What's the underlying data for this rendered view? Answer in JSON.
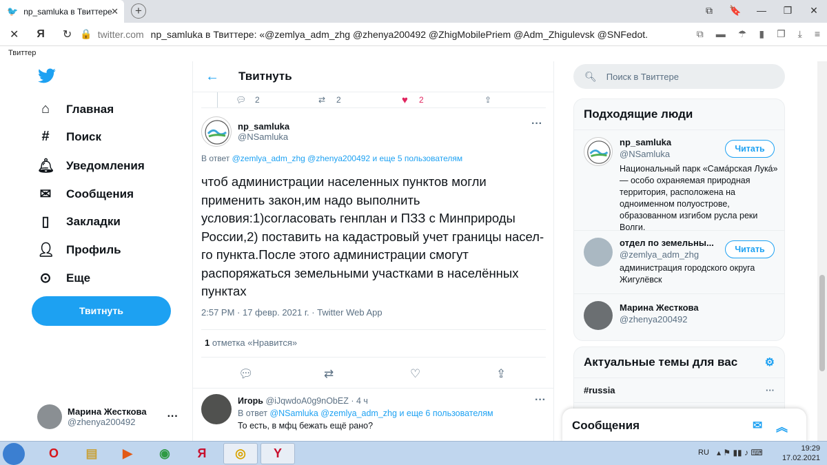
{
  "browser": {
    "tab_title": "np_samluka в Твиттере",
    "tab_close": "✕",
    "new_tab": "+",
    "win_buttons": [
      "⧉",
      "🔖",
      "—",
      "❐",
      "✕"
    ],
    "host": "twitter.com",
    "page_title": "np_samluka в Твиттере: «@zemlya_adm_zhg @zhenya200492 @ZhigMobilePriem @Adm_Zhigulevsk @SNFedot...",
    "bookmark": "Твиттер"
  },
  "nav": {
    "items": [
      {
        "icon": "home-icon",
        "label": "Главная"
      },
      {
        "icon": "hashtag-icon",
        "label": "Поиск"
      },
      {
        "icon": "bell-icon",
        "label": "Уведомления"
      },
      {
        "icon": "mail-icon",
        "label": "Сообщения"
      },
      {
        "icon": "bookmark-icon",
        "label": "Закладки"
      },
      {
        "icon": "profile-icon",
        "label": "Профиль"
      },
      {
        "icon": "more-icon",
        "label": "Еще"
      }
    ],
    "tweet_button": "Твитнуть",
    "me_name": "Марина Жесткова",
    "me_handle": "@zhenya200492",
    "me_dots": "···"
  },
  "center": {
    "header_title": "Твитнуть",
    "prev_counts": {
      "reply": "2",
      "retweet": "2",
      "like": "2"
    },
    "tweet": {
      "name": "np_samluka",
      "handle": "@NSamluka",
      "dots": "···",
      "reply_prefix": "В ответ",
      "reply_to": "@zemlya_adm_zhg @zhenya200492",
      "reply_more": "и еще 5 пользователям",
      "text": "чтоб администрации населенных пунктов могли применить закон,им надо выполнить условия:1)согласовать генплан и ПЗЗ с Минприроды России,2) поставить на кадастровый учет границы насел-го пункта.После этого администрации смогут распоряжаться земельными участками в населённых пунктах",
      "meta": "2:57 PM · 17 февр. 2021 г. · Twitter Web App",
      "likes_count": "1",
      "likes_label": "отметка «Нравится»"
    },
    "reply": {
      "name": "Игорь",
      "handle_time": "@iJqwdoA0g9nObEZ · 4 ч",
      "reply_prefix": "В ответ",
      "reply_to": "@NSamluka @zemlya_adm_zhg",
      "reply_more": "и еще 6 пользователям",
      "text": "То есть, в мфц бежать ещё рано?",
      "dots": "···"
    }
  },
  "right": {
    "search_placeholder": "Поиск в Твиттере",
    "people_title": "Подходящие люди",
    "follow_label": "Читать",
    "people": [
      {
        "name": "np_samluka",
        "handle": "@NSamluka",
        "bio": "Национальный парк «Самáрская Лукá» — особо охраняемая природная территория, расположена на одноименном полуострове, образованном изгибом русла реки Волги."
      },
      {
        "name": "отдел по земельны...",
        "handle": "@zemlya_adm_zhg",
        "bio": "администрация городского округа Жигулёвск"
      },
      {
        "name": "Марина Жесткова",
        "handle": "@zhenya200492",
        "bio": ""
      }
    ],
    "trends_title": "Актуальные темы для вас",
    "trends": [
      {
        "label": "#russia",
        "dots": "···"
      },
      {
        "label": "",
        "dots": "···"
      }
    ],
    "messages_title": "Сообщения"
  },
  "taskbar": {
    "lang": "RU",
    "time": "19:29",
    "date": "17.02.2021"
  },
  "colors": {
    "accent": "#1da1f2",
    "like": "#e0245e"
  }
}
